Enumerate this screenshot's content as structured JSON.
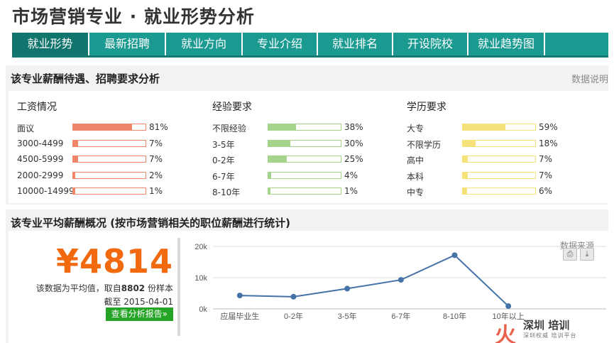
{
  "page": {
    "title": "市场营销专业 · 就业形势分析"
  },
  "tabs": [
    {
      "label": "就业形势",
      "active": true
    },
    {
      "label": "最新招聘",
      "active": false
    },
    {
      "label": "就业方向",
      "active": false
    },
    {
      "label": "专业介绍",
      "active": false
    },
    {
      "label": "就业排名",
      "active": false
    },
    {
      "label": "开设院校",
      "active": false
    },
    {
      "label": "就业趋势图",
      "active": false
    }
  ],
  "requirements": {
    "heading": "该专业薪酬待遇、招聘要求分析",
    "help_link": "数据说明",
    "columns": [
      {
        "title": "工资情况",
        "color": "#f0876a",
        "rows": [
          {
            "label": "面议",
            "value": 81,
            "pct": "81%"
          },
          {
            "label": "3000-4499",
            "value": 7,
            "pct": "7%"
          },
          {
            "label": "4500-5999",
            "value": 7,
            "pct": "7%"
          },
          {
            "label": "2000-2999",
            "value": 2,
            "pct": "2%"
          },
          {
            "label": "10000-14999",
            "value": 1,
            "pct": "1%"
          }
        ]
      },
      {
        "title": "经验要求",
        "color": "#a4d48a",
        "rows": [
          {
            "label": "不限经验",
            "value": 38,
            "pct": "38%"
          },
          {
            "label": "3-5年",
            "value": 30,
            "pct": "30%"
          },
          {
            "label": "0-2年",
            "value": 25,
            "pct": "25%"
          },
          {
            "label": "6-7年",
            "value": 4,
            "pct": "4%"
          },
          {
            "label": "8-10年",
            "value": 1,
            "pct": "1%"
          }
        ]
      },
      {
        "title": "学历要求",
        "color": "#f5e27a",
        "rows": [
          {
            "label": "大专",
            "value": 59,
            "pct": "59%"
          },
          {
            "label": "不限学历",
            "value": 18,
            "pct": "18%"
          },
          {
            "label": "高中",
            "value": 7,
            "pct": "7%"
          },
          {
            "label": "本科",
            "value": 7,
            "pct": "7%"
          },
          {
            "label": "中专",
            "value": 6,
            "pct": "6%"
          }
        ]
      }
    ]
  },
  "salary": {
    "heading": "该专业平均薪酬概况 (按市场营销相关的职位薪酬进行统计)",
    "value": "¥4814",
    "note_prefix": "该数据为平均值，取自",
    "sample_count": "8802",
    "note_suffix": "份样本",
    "date_line": "截至 2015-04-01",
    "report_button": "查看分析报告»",
    "source_label": "数据来源",
    "print_icon": "printer-icon",
    "download_icon": "download-icon"
  },
  "chart_data": {
    "type": "line",
    "categories": [
      "应届毕业生",
      "0-2年",
      "3-5年",
      "6-7年",
      "8-10年",
      "10年以上"
    ],
    "values": [
      4300,
      3900,
      6500,
      9300,
      17200,
      900
    ],
    "ylim": [
      0,
      20000
    ],
    "yticks": [
      0,
      10000,
      20000
    ],
    "ytick_labels": [
      "0k",
      "10k",
      "20k"
    ],
    "grid": true,
    "color": "#4572a7"
  },
  "watermark": {
    "mark": "火",
    "name": "深圳 培训",
    "tagline": "深圳权威 培训平台"
  }
}
